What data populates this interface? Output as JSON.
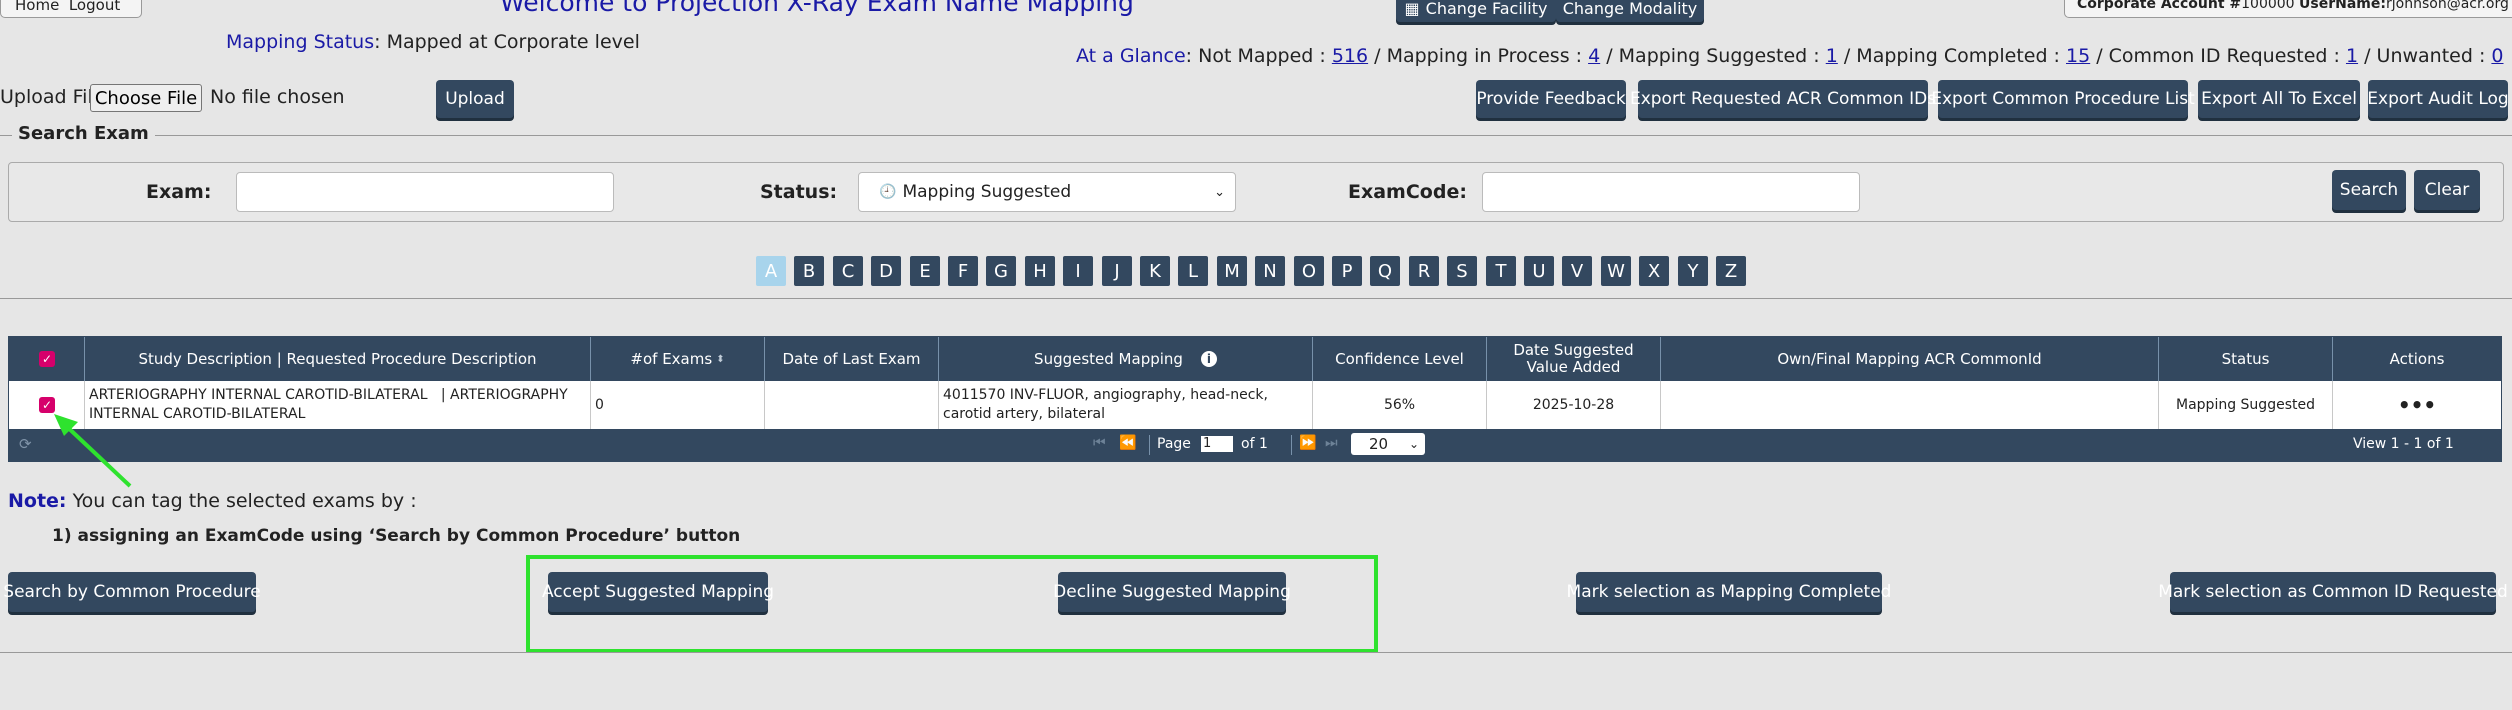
{
  "nav": {
    "home": "Home",
    "logout": "Logout"
  },
  "header": {
    "title": "Welcome to Projection X-Ray Exam Name Mapping",
    "change_facility": "Change Facility",
    "change_modality": "Change Modality",
    "account_label": "Corporate Account #",
    "account_number": "100000",
    "username_label": "UserName:",
    "username": "rjohnson@acr.org"
  },
  "mapping_status": {
    "label": "Mapping Status",
    "value": ": Mapped at Corporate level"
  },
  "glance": {
    "label": "At a Glance",
    "items": [
      {
        "label": ": Not Mapped : ",
        "count": "516"
      },
      {
        "label": " / Mapping in Process : ",
        "count": "4"
      },
      {
        "label": " / Mapping Suggested : ",
        "count": "1"
      },
      {
        "label": " / Mapping Completed : ",
        "count": "15"
      },
      {
        "label": " / Common ID Requested : ",
        "count": "1"
      },
      {
        "label": " / Unwanted : ",
        "count": "0"
      }
    ]
  },
  "upload": {
    "label": "Upload File",
    "choose": "Choose File",
    "no_file": "No file chosen",
    "button": "Upload"
  },
  "toolbar": {
    "feedback": "Provide Feedback",
    "export_acr": "Export Requested ACR Common IDs",
    "export_common": "Export Common Procedure List",
    "export_excel": "Export All To Excel",
    "export_audit": "Export Audit Log"
  },
  "search": {
    "legend": "Search Exam",
    "exam_label": "Exam:",
    "status_label": "Status:",
    "status_value": "Mapping Suggested",
    "examcode_label": "ExamCode:",
    "search_button": "Search",
    "clear_button": "Clear"
  },
  "letters": [
    "A",
    "B",
    "C",
    "D",
    "E",
    "F",
    "G",
    "H",
    "I",
    "J",
    "K",
    "L",
    "M",
    "N",
    "O",
    "P",
    "Q",
    "R",
    "S",
    "T",
    "U",
    "V",
    "W",
    "X",
    "Y",
    "Z"
  ],
  "active_letter": "A",
  "table": {
    "headers": {
      "study": "Study Description | Requested Procedure Description",
      "exams": "#of Exams",
      "last_exam": "Date of Last Exam",
      "suggested": "Suggested Mapping",
      "confidence": "Confidence Level",
      "date_suggested": "Date Suggested Value Added",
      "own_final": "Own/Final Mapping ACR CommonId",
      "status": "Status",
      "actions": "Actions"
    },
    "rows": [
      {
        "study": "ARTERIOGRAPHY INTERNAL CAROTID-BILATERAL   | ARTERIOGRAPHY INTERNAL CAROTID-BILATERAL",
        "exams": "0",
        "last_exam": "",
        "suggested": "4011570 INV-FLUOR, angiography, head-neck, carotid artery, bilateral",
        "confidence": "56%",
        "date_suggested": "2025-10-28",
        "own_final": "",
        "status": "Mapping Suggested",
        "actions": "•••"
      }
    ],
    "pager": {
      "page_label": "Page",
      "page_value": "1",
      "of_label": "of 1",
      "page_size": "20",
      "view": "View 1 - 1 of 1"
    }
  },
  "note": {
    "label": "Note:",
    "text": " You can tag the selected exams by :",
    "item1": "1) assigning an ExamCode using ‘Search by Common Procedure’ button"
  },
  "actions": {
    "search_common": "Search by Common Procedure",
    "accept": "Accept Suggested Mapping",
    "decline": "Decline Suggested Mapping",
    "mark_completed": "Mark selection as Mapping Completed",
    "mark_common_id": "Mark selection as Common ID Requested"
  },
  "colors": {
    "button_navy": "#33485f",
    "highlight_green": "#2ee22e",
    "checkbox_pink": "#d6006b",
    "link_blue": "#1a1aa6",
    "active_letter": "#a8d4ec"
  }
}
